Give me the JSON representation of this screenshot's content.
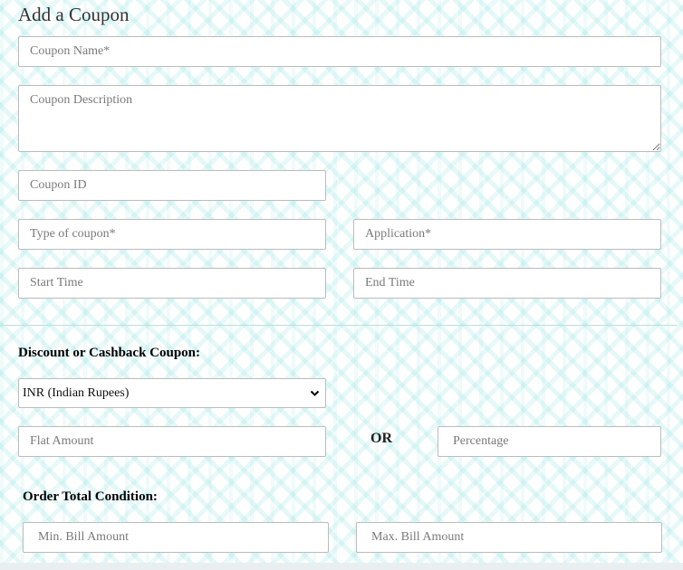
{
  "page": {
    "title": "Add a Coupon"
  },
  "form": {
    "coupon_name": {
      "placeholder": "Coupon Name*",
      "value": ""
    },
    "coupon_description": {
      "placeholder": "Coupon Description",
      "value": ""
    },
    "coupon_id": {
      "placeholder": "Coupon ID",
      "value": ""
    },
    "type_of_coupon": {
      "placeholder": "Type of coupon*",
      "value": ""
    },
    "application": {
      "placeholder": "Application*",
      "value": ""
    },
    "start_time": {
      "placeholder": "Start Time",
      "value": ""
    },
    "end_time": {
      "placeholder": "End Time",
      "value": ""
    }
  },
  "discount": {
    "heading": "Discount or Cashback Coupon:",
    "currency_selected": "INR (Indian Rupees)",
    "currency_icon": "chevron-down-icon",
    "flat_amount": {
      "placeholder": "Flat Amount",
      "value": ""
    },
    "or_label": "OR",
    "percentage": {
      "placeholder": "Percentage",
      "value": ""
    }
  },
  "order_condition": {
    "heading": "Order Total Condition:",
    "min_bill": {
      "placeholder": "Min. Bill Amount",
      "value": ""
    },
    "max_bill": {
      "placeholder": "Max. Bill Amount",
      "value": ""
    }
  },
  "colors": {
    "background_pattern": "#aae8e8",
    "divider": "#b9dedd",
    "field_border": "#bcbcbc"
  }
}
